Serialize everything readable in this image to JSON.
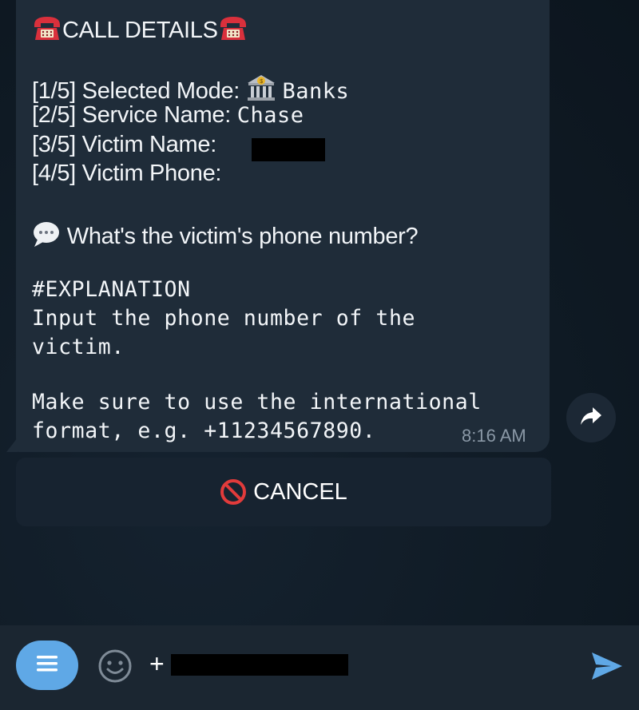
{
  "message": {
    "header": "CALL DETAILS",
    "fields": [
      {
        "label": "[1/5] Selected Mode:",
        "value": "Banks",
        "icon": "bank-icon"
      },
      {
        "label": "[2/5] Service Name:",
        "value": "Chase"
      },
      {
        "label": "[3/5] Victim Name:",
        "value": ""
      },
      {
        "label": "[4/5] Victim Phone:",
        "value": ""
      }
    ],
    "prompt": "What's the victim's phone number?",
    "explanation_heading": "#EXPLANATION",
    "explanation_lines": [
      "Input the phone number of the",
      "victim.",
      "Make sure to use the international",
      "format, e.g. +11234567890."
    ],
    "time": "8:16 AM"
  },
  "cancel_button": {
    "label": "CANCEL",
    "icon": "prohibited-icon"
  },
  "input_bar": {
    "text": "+",
    "menu_icon": "menu-icon",
    "emoji_icon": "emoji-icon",
    "send_icon": "send-icon"
  },
  "colors": {
    "background": "#0f1a24",
    "bubble": "#1f2c39",
    "keyboard_button": "#172330",
    "accent": "#5fa8e6",
    "timestamp": "#8a98a6"
  }
}
